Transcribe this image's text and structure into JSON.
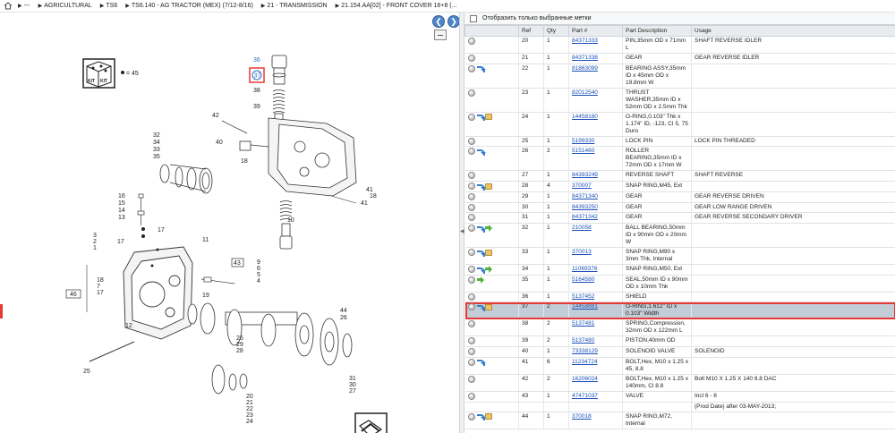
{
  "breadcrumb": [
    "---",
    "AGRICULTURAL",
    "TS6",
    "TS6.140 - AG TRACTOR (MEX) (7/12-8/16)",
    "21 - TRANSMISSION",
    "21.154.AA[02] - FRONT COVER 16+8 (..."
  ],
  "filter_label": "Отобразить только выбранные метки",
  "columns": [
    "Ref",
    "Qty",
    "Part #",
    "Part Description",
    "Usage"
  ],
  "kit_label": "= 45",
  "rows": [
    {
      "icons": [],
      "ref": "20",
      "qty": "1",
      "part": "84371333",
      "desc": "PIN,35mm OD x 71mm L",
      "usage": "SHAFT REVERSE IDLER"
    },
    {
      "icons": [],
      "ref": "21",
      "qty": "1",
      "part": "84371338",
      "desc": "GEAR",
      "usage": "GEAR REVERSE IDLER"
    },
    {
      "icons": [
        "blue"
      ],
      "ref": "22",
      "qty": "1",
      "part": "81863099",
      "desc": "BEARING ASSY,35mm ID x 45mm OD x 19.8mm W",
      "usage": ""
    },
    {
      "icons": [],
      "ref": "23",
      "qty": "1",
      "part": "82012540",
      "desc": "THRUST WASHER,35mm ID x 52mm OD x 2.5mm Thk",
      "usage": ""
    },
    {
      "icons": [
        "blue",
        "box"
      ],
      "ref": "24",
      "qty": "1",
      "part": "14458180",
      "desc": "O-RING,0.103\" Thk x 1.174\" ID, -123, CI 5, 75 Duro",
      "usage": ""
    },
    {
      "icons": [],
      "ref": "25",
      "qty": "1",
      "part": "5199330",
      "desc": "LOCK PIN",
      "usage": "LOCK PIN THREADED"
    },
    {
      "icons": [
        "blue"
      ],
      "ref": "26",
      "qty": "2",
      "part": "5151460",
      "desc": "ROLLER BEARING,35mm ID x 72mm OD x 17mm W",
      "usage": ""
    },
    {
      "icons": [],
      "ref": "27",
      "qty": "1",
      "part": "84393249",
      "desc": "REVERSE SHAFT",
      "usage": "SHAFT REVERSE"
    },
    {
      "icons": [
        "blue",
        "box"
      ],
      "ref": "28",
      "qty": "4",
      "part": "370007",
      "desc": "SNAP RING,M45, Ext",
      "usage": ""
    },
    {
      "icons": [],
      "ref": "29",
      "qty": "1",
      "part": "84371340",
      "desc": "GEAR",
      "usage": "GEAR REVERSE DRIVEN"
    },
    {
      "icons": [],
      "ref": "30",
      "qty": "1",
      "part": "84393250",
      "desc": "GEAR",
      "usage": "GEAR LOW RANGE DRIVEN"
    },
    {
      "icons": [],
      "ref": "31",
      "qty": "1",
      "part": "84371342",
      "desc": "GEAR",
      "usage": "GEAR REVERSE SECONDARY DRIVER"
    },
    {
      "icons": [
        "blue",
        "green"
      ],
      "ref": "32",
      "qty": "1",
      "part": "210058",
      "desc": "BALL BEARING,50mm ID x 90mm OD x 20mm W",
      "usage": ""
    },
    {
      "icons": [
        "blue",
        "box"
      ],
      "ref": "33",
      "qty": "1",
      "part": "370013",
      "desc": "SNAP RING,M90 x 3mm Thk, Internal",
      "usage": ""
    },
    {
      "icons": [
        "blue",
        "green"
      ],
      "ref": "34",
      "qty": "1",
      "part": "11069376",
      "desc": "SNAP RING,M50, Ext",
      "usage": ""
    },
    {
      "icons": [
        "green"
      ],
      "ref": "35",
      "qty": "1",
      "part": "5164580",
      "desc": "SEAL,50mm ID x 90mm OD x 10mm Thk",
      "usage": ""
    },
    {
      "icons": [],
      "ref": "36",
      "qty": "1",
      "part": "5137452",
      "desc": "SHIELD",
      "usage": ""
    },
    {
      "icons": [
        "blue",
        "box"
      ],
      "ref": "37",
      "qty": "2",
      "part": "14458881",
      "desc": "O-RING,1.612\" ID x 0.103\" Width",
      "usage": "",
      "selected": true
    },
    {
      "icons": [],
      "ref": "38",
      "qty": "2",
      "part": "5137481",
      "desc": "SPRING,Compression, 32mm OD x 122mm L",
      "usage": ""
    },
    {
      "icons": [],
      "ref": "39",
      "qty": "2",
      "part": "5137480",
      "desc": "PISTON,40mm OD",
      "usage": ""
    },
    {
      "icons": [],
      "ref": "40",
      "qty": "1",
      "part": "73338129",
      "desc": "SOLENOID VALVE",
      "usage": "SOLENOID"
    },
    {
      "icons": [
        "blue"
      ],
      "ref": "41",
      "qty": "6",
      "part": "11234724",
      "desc": "BOLT,Hex, M10 x 1.25 x 45, 8.8",
      "usage": ""
    },
    {
      "icons": [],
      "ref": "42",
      "qty": "2",
      "part": "16206024",
      "desc": "BOLT,Hex, M10 x 1.25 x 140mm, Cl 8.8",
      "usage": "Bolt M10 X 1.25 X 140 8.8 DAC"
    },
    {
      "icons": [],
      "ref": "43",
      "qty": "1",
      "part": "47471037",
      "desc": "VALVE",
      "usage": "Incl 6 - 8"
    },
    {
      "icons": [],
      "ref": "",
      "qty": "",
      "part": "",
      "desc": "",
      "usage": "(Prod Date) after 03-MAY-2013;"
    },
    {
      "icons": [
        "blue",
        "box"
      ],
      "ref": "44",
      "qty": "1",
      "part": "370018",
      "desc": "SNAP RING,M72, Internal",
      "usage": ""
    }
  ],
  "callouts": {
    "c36": "36",
    "c37": "37",
    "c38": "38",
    "c39": "39",
    "c40": "40",
    "c42": "42",
    "c32": "32",
    "c34": "34",
    "c33": "33",
    "c35": "35",
    "c18a": "18",
    "c16": "16",
    "c15": "15",
    "c14": "14",
    "c13": "13",
    "c17a": "17",
    "c3": "3",
    "c2": "2",
    "c1": "1",
    "c17b": "17",
    "c11": "11",
    "c43": "43",
    "c9": "9",
    "c6": "6",
    "c5": "5",
    "c4": "4",
    "c19": "19",
    "c18b": "18",
    "c7": "7",
    "c17c": "17",
    "c46": "46",
    "c12": "12",
    "c41a": "41",
    "c18c": "18",
    "c41b": "41",
    "c10": "10",
    "c44": "44",
    "c26a": "26",
    "c26b": "26",
    "c29": "29",
    "c28": "28",
    "c25": "25",
    "c31": "31",
    "c30": "30",
    "c27": "27",
    "c20": "20",
    "c21": "21",
    "c22": "22",
    "c23": "23",
    "c24": "24"
  },
  "colors": {
    "selected_row": "#c3cdd8",
    "highlight": "#e53935",
    "link": "#1a4fb8"
  }
}
